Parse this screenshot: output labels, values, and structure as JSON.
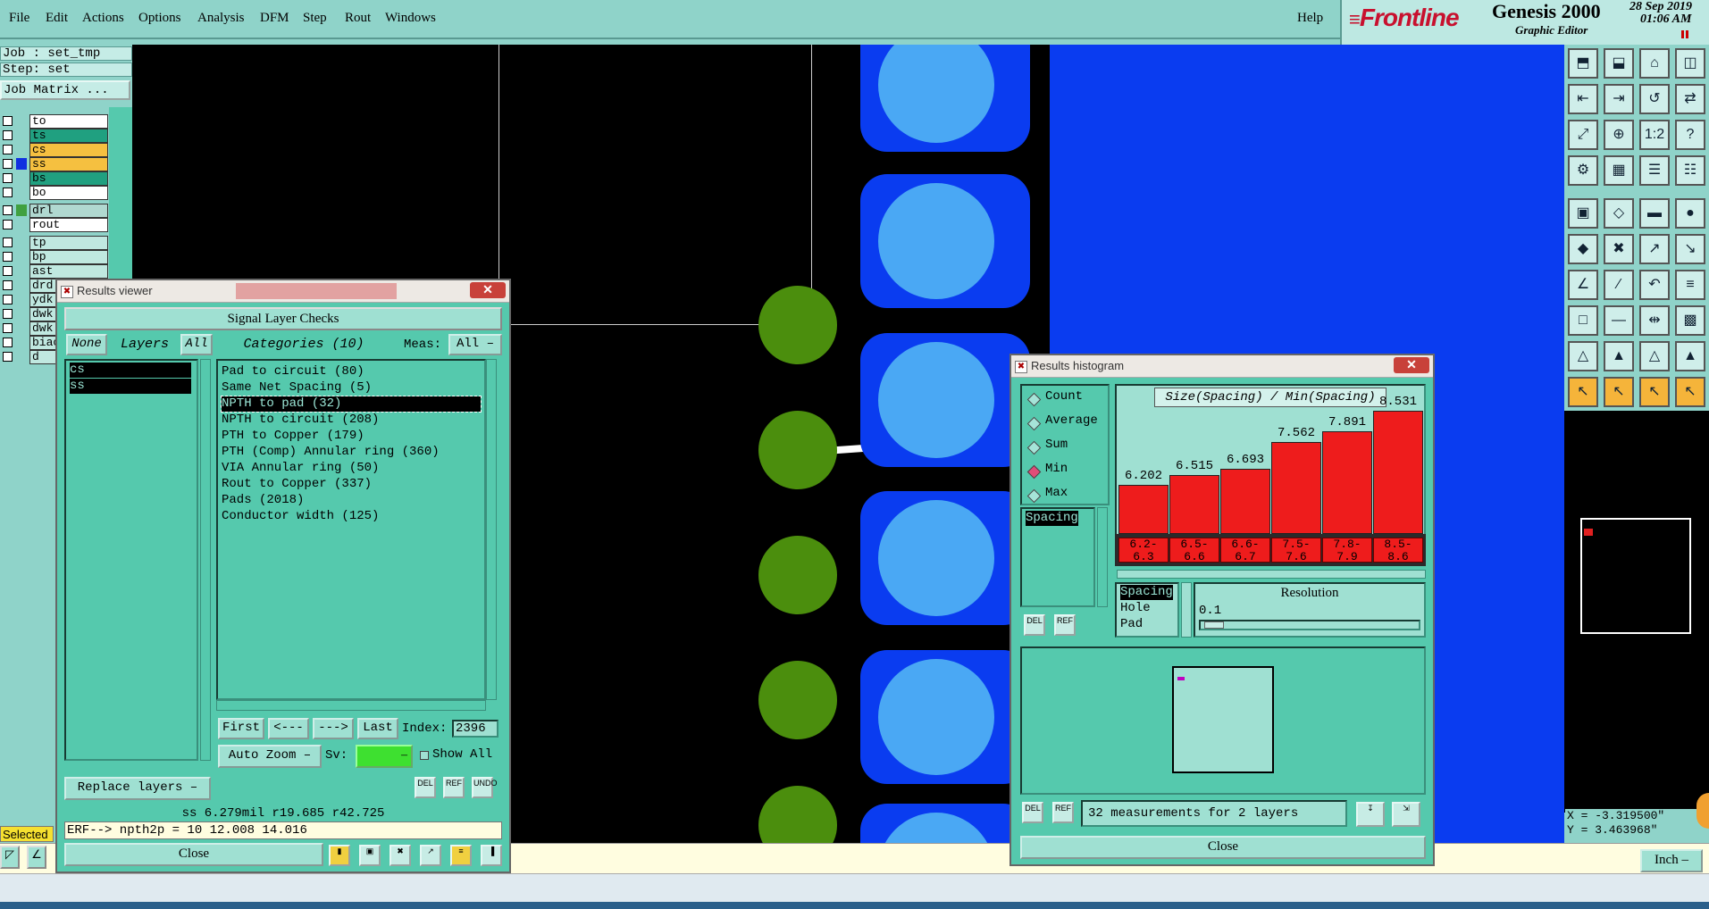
{
  "menu": [
    "File",
    "Edit",
    "Actions",
    "Options",
    "Analysis",
    "DFM",
    "Step",
    "Rout",
    "Windows"
  ],
  "help": "Help",
  "brand": {
    "logo": "Frontline",
    "product": "Genesis 2000",
    "subtitle": "Graphic Editor",
    "date": "28 Sep 2019",
    "time": "01:06 AM"
  },
  "job": {
    "job": "Job : set_tmp",
    "step": "Step: set",
    "matrix_btn": "Job Matrix ..."
  },
  "layers": [
    {
      "name": "to",
      "color": "#ffffff",
      "bg": "#ffffff"
    },
    {
      "name": "ts",
      "color": "#20a080",
      "bg": "#20a080"
    },
    {
      "name": "cs",
      "color": "#f5c040",
      "bg": "#f5c040"
    },
    {
      "name": "ss",
      "color": "#1030e0",
      "bg": "#f5c040"
    },
    {
      "name": "bs",
      "color": "#20a080",
      "bg": "#20a080"
    },
    {
      "name": "bo",
      "color": "#ffffff",
      "bg": "#ffffff"
    },
    {
      "name": "drl",
      "color": "#40a040",
      "bg": "#b0d8d0"
    },
    {
      "name": "rout",
      "color": "#ffffff",
      "bg": "#ffffff"
    },
    {
      "name": "tp",
      "color": "#c0e8e0",
      "bg": "#c0e8e0"
    },
    {
      "name": "bp",
      "color": "#c0e8e0",
      "bg": "#c0e8e0"
    },
    {
      "name": "ast",
      "color": "#c0e8e0",
      "bg": "#c0e8e0"
    },
    {
      "name": "drd",
      "color": "#c0e8e0",
      "bg": "#c0e8e0"
    },
    {
      "name": "ydk",
      "color": "#c0e8e0",
      "bg": "#c0e8e0"
    },
    {
      "name": "dwk",
      "color": "#c0e8e0",
      "bg": "#c0e8e0"
    },
    {
      "name": "dwk",
      "color": "#c0e8e0",
      "bg": "#c0e8e0"
    },
    {
      "name": "biac",
      "color": "#c0e8e0",
      "bg": "#c0e8e0"
    },
    {
      "name": "d",
      "color": "#c0e8e0",
      "bg": "#c0e8e0"
    }
  ],
  "selected_label": "Selected",
  "results_viewer": {
    "title": "Results viewer",
    "header": "Signal Layer Checks",
    "none_btn": "None",
    "layers_label": "Layers",
    "all_btn": "All",
    "categories_label": "Categories (10)",
    "meas_label": "Meas:",
    "meas_value": "All",
    "layer_items": [
      "cs",
      "ss"
    ],
    "categories": [
      "Pad to circuit (80)",
      "Same Net Spacing (5)",
      "NPTH to pad (32)",
      "NPTH to circuit (208)",
      "PTH to Copper (179)",
      "PTH (Comp) Annular ring (360)",
      "VIA Annular ring (50)",
      "Rout to Copper (337)",
      "Pads (2018)",
      "Conductor width (125)"
    ],
    "selected_category": 2,
    "first_btn": "First",
    "prev_btn": "<---",
    "next_btn": "--->",
    "last_btn": "Last",
    "index_label": "Index:",
    "index_value": "2396",
    "auto_zoom": "Auto Zoom",
    "sv_label": "Sv:",
    "show_all": "Show All",
    "replace_layers": "Replace layers",
    "del": "DEL",
    "ref": "REF",
    "undo": "UNDO",
    "status1": "ss 6.279mil   r19.685  r42.725",
    "status2": "ERF--> npth2p = 10 12.008 14.016",
    "close": "Close"
  },
  "histogram": {
    "title": "Results histogram",
    "modes": [
      "Count",
      "Average",
      "Sum",
      "Min",
      "Max"
    ],
    "selected_mode": 3,
    "list_items": [
      "Spacing"
    ],
    "chart_title": "Size(Spacing) / Min(Spacing)",
    "bars": [
      {
        "value": "6.202",
        "range": "6.2-\n6.3"
      },
      {
        "value": "6.515",
        "range": "6.5-\n6.6"
      },
      {
        "value": "6.693",
        "range": "6.6-\n6.7"
      },
      {
        "value": "7.562",
        "range": "7.5-\n7.6"
      },
      {
        "value": "7.891",
        "range": "7.8-\n7.9"
      },
      {
        "value": "8.531",
        "range": "8.5-\n8.6"
      }
    ],
    "type_list": [
      "Spacing",
      "Hole",
      "Pad"
    ],
    "resolution_label": "Resolution",
    "resolution_value": "0.1",
    "measurements": "32 measurements for 2 layers",
    "close": "Close"
  },
  "chart_data": {
    "type": "bar",
    "title": "Size(Spacing) / Min(Spacing)",
    "categories": [
      "6.2-6.3",
      "6.5-6.6",
      "6.6-6.7",
      "7.5-7.6",
      "7.8-7.9",
      "8.5-8.6"
    ],
    "values": [
      6.202,
      6.515,
      6.693,
      7.562,
      7.891,
      8.531
    ],
    "xlabel": "",
    "ylabel": ""
  },
  "coords": {
    "x": "X = -3.319500\"",
    "y": "Y = 3.463968\""
  },
  "units": "Inch",
  "colors": {
    "bg": "#8fd3c9",
    "panel": "#55c9ad",
    "bar": "#ee1c1c",
    "copper": "#0a3cf0",
    "pad": "#4aa8f4",
    "via": "#4b8e0d"
  }
}
